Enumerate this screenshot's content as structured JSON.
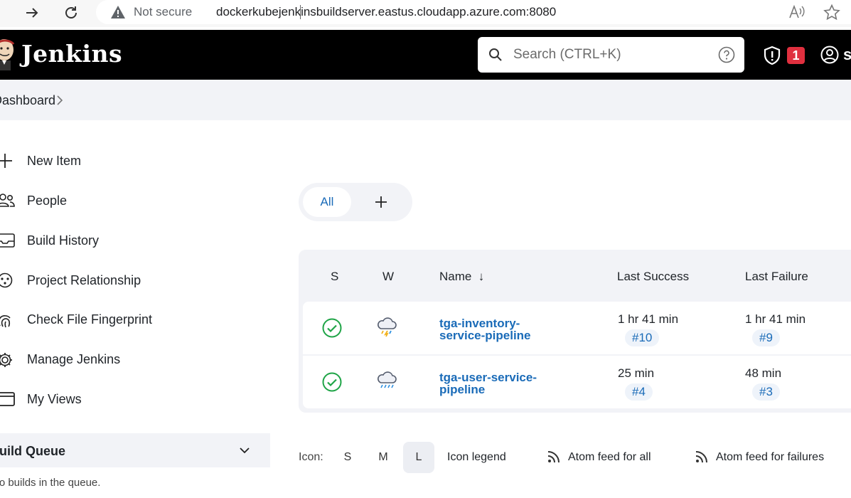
{
  "browser": {
    "security_label": "Not secure",
    "url": "dockerkubejenkinsbuildserver.eastus.cloudapp.azure.com:8080"
  },
  "header": {
    "title": "Jenkins",
    "search_placeholder": "Search (CTRL+K)",
    "security_badge": "1",
    "user_initial": "s"
  },
  "breadcrumb": {
    "items": [
      "Dashboard"
    ]
  },
  "sidebar": {
    "items": [
      {
        "label": "New Item",
        "icon": "plus-icon"
      },
      {
        "label": "People",
        "icon": "people-icon"
      },
      {
        "label": "Build History",
        "icon": "inbox-icon"
      },
      {
        "label": "Project Relationship",
        "icon": "relationship-icon"
      },
      {
        "label": "Check File Fingerprint",
        "icon": "fingerprint-icon"
      },
      {
        "label": "Manage Jenkins",
        "icon": "gear-icon"
      },
      {
        "label": "My Views",
        "icon": "window-icon"
      }
    ],
    "build_queue": {
      "title": "Build Queue",
      "empty_text": "No builds in the queue."
    }
  },
  "views": {
    "tabs": [
      "All"
    ],
    "add_label": "+"
  },
  "jobs_table": {
    "headers": {
      "status": "S",
      "weather": "W",
      "name": "Name  ↓",
      "last_success": "Last Success",
      "last_failure": "Last Failure"
    },
    "rows": [
      {
        "status": "success",
        "weather": "thunderstorm-icon",
        "name": "tga-inventory-service-pipeline",
        "name_line1": "tga-inventory-",
        "name_line2": "service-pipeline",
        "last_success_time": "1 hr 41 min",
        "last_success_build": "#10",
        "last_failure_time": "1 hr 41 min",
        "last_failure_build": "#9"
      },
      {
        "status": "success",
        "weather": "rain-cloud-icon",
        "name": "tga-user-service-pipeline",
        "name_line1": "tga-user-service-",
        "name_line2": "pipeline",
        "last_success_time": "25 min",
        "last_success_build": "#4",
        "last_failure_time": "48 min",
        "last_failure_build": "#3"
      }
    ]
  },
  "footer": {
    "icon_label": "Icon:",
    "sizes": [
      "S",
      "M",
      "L"
    ],
    "selected_size": "L",
    "legend": "Icon legend",
    "feed_all": "Atom feed for all",
    "feed_failures": "Atom feed for failures"
  },
  "colors": {
    "accent": "#1a6bb8",
    "success": "#1ea446",
    "badge": "#e0303f",
    "header_bg": "#000000"
  }
}
